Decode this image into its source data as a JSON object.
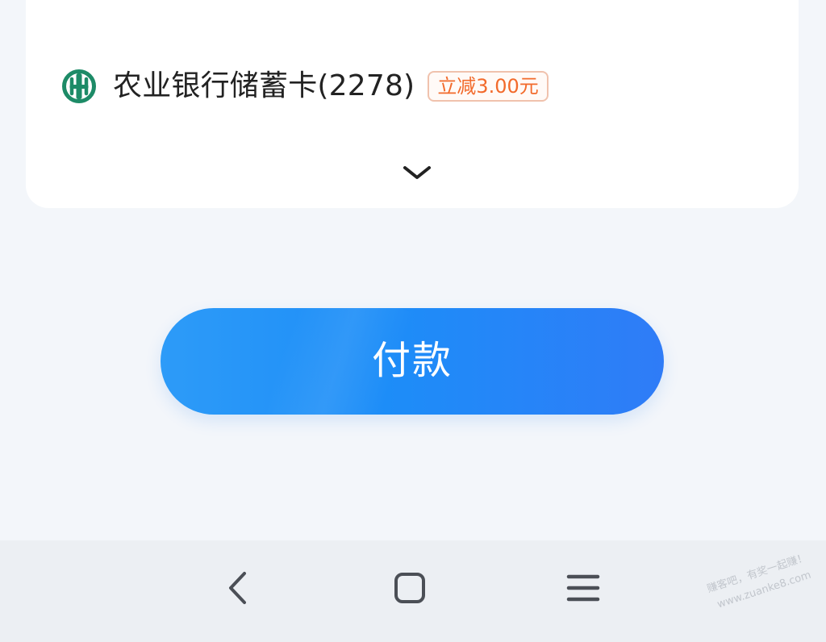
{
  "payment_method": {
    "bank_name": "农业银行储蓄卡(2278)",
    "discount_badge": "立减3.00元",
    "bank_icon": "agricultural-bank-logo-icon",
    "expand_icon": "chevron-down-icon"
  },
  "actions": {
    "pay_label": "付款"
  },
  "system_navigation": {
    "back_icon": "back-icon",
    "home_icon": "home-icon",
    "menu_icon": "menu-icon"
  },
  "watermark": {
    "line1": "赚客吧，有奖一起赚！",
    "line2": "www.zuanke8.com"
  },
  "colors": {
    "background": "#f3f6fa",
    "card_background": "#ffffff",
    "bank_icon": "#1d8b67",
    "discount_text": "#f26a2b",
    "discount_border": "#f0c2ad",
    "pay_button_start": "#2d9bf8",
    "pay_button_end": "#2f7cf7",
    "navigation_bar": "#eceff3",
    "navigation_icon": "#4b4f56"
  }
}
